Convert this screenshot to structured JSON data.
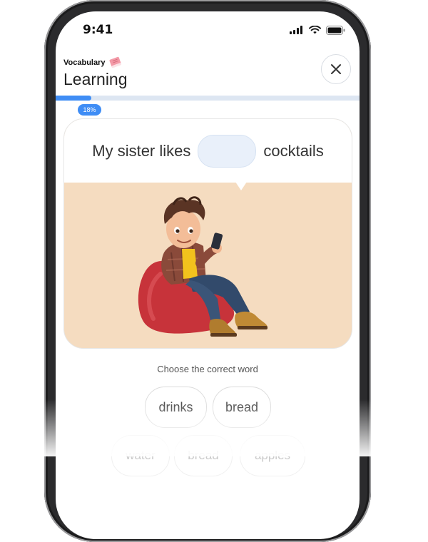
{
  "status_bar": {
    "time": "9:41",
    "icons": [
      "signal-icon",
      "wifi-icon",
      "battery-icon"
    ]
  },
  "header": {
    "category": "Vocabulary",
    "category_icon": "book-icon",
    "title": "Learning",
    "close_icon": "close-icon"
  },
  "progress": {
    "percent": 18,
    "label": "18%"
  },
  "exercise": {
    "sentence_before": "My sister likes",
    "sentence_after": "cocktails",
    "illustration": "boy-on-beanbag-with-phone"
  },
  "instruction": "Choose the correct word",
  "options": [
    {
      "label": "drinks"
    },
    {
      "label": "bread"
    },
    {
      "label": "water"
    },
    {
      "label": "bread"
    },
    {
      "label": "apples"
    }
  ],
  "colors": {
    "accent": "#3f8df5",
    "card_background": "#f5dcc0",
    "blank_fill": "#e9f0fa"
  }
}
